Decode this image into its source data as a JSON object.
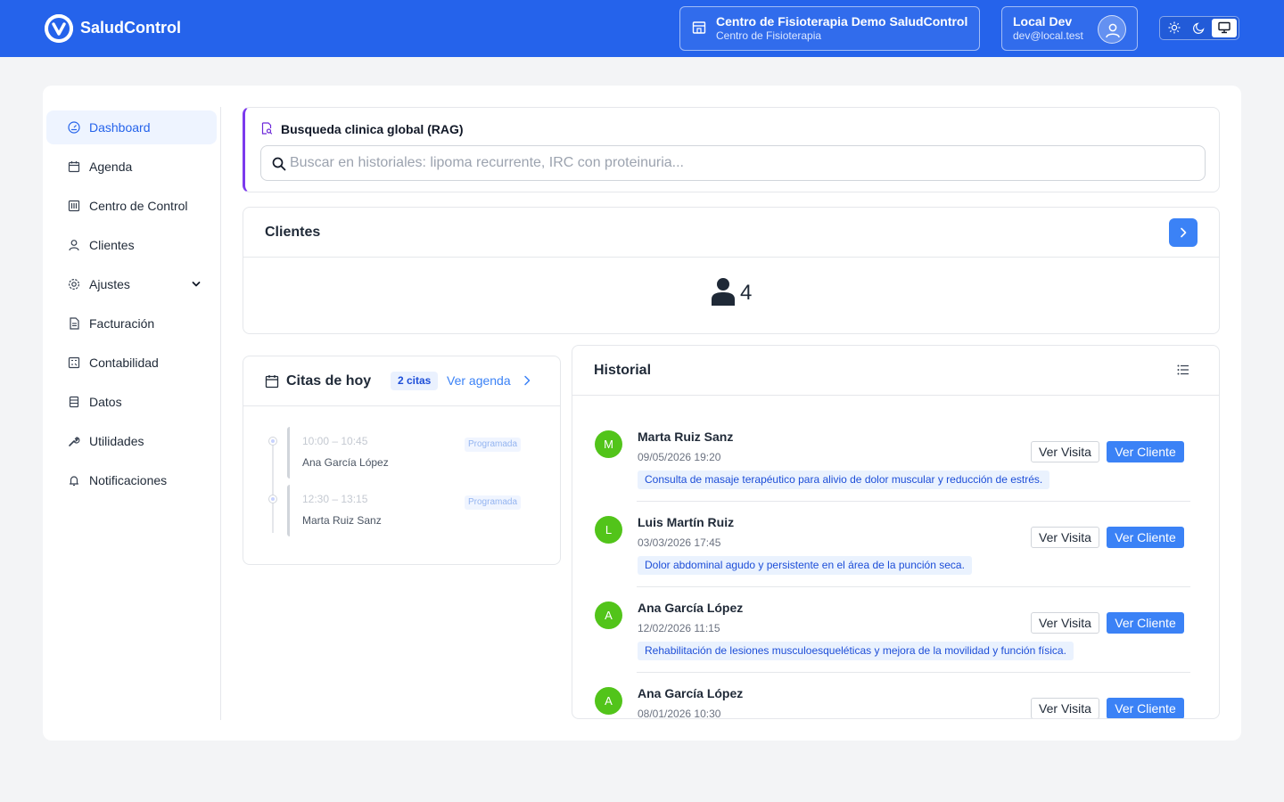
{
  "header": {
    "brand": "SaludControl",
    "center_name": "Centro de Fisioterapia Demo SaludControl",
    "center_type": "Centro de Fisioterapia",
    "user_name": "Local Dev",
    "user_email": "dev@local.test",
    "theme_options": [
      "light-mode-icon",
      "dark-mode-icon",
      "system-mode-icon"
    ],
    "theme_selected": "system"
  },
  "sidebar": {
    "items": [
      {
        "label": "Dashboard",
        "icon": "dashboard-icon",
        "active": true
      },
      {
        "label": "Agenda",
        "icon": "calendar-icon"
      },
      {
        "label": "Centro de Control",
        "icon": "control-panel-icon"
      },
      {
        "label": "Clientes",
        "icon": "user-icon"
      },
      {
        "label": "Ajustes",
        "icon": "gear-icon",
        "expandable": true
      },
      {
        "label": "Facturación",
        "icon": "invoice-icon"
      },
      {
        "label": "Contabilidad",
        "icon": "calculator-icon"
      },
      {
        "label": "Datos",
        "icon": "database-icon"
      },
      {
        "label": "Utilidades",
        "icon": "wrench-icon"
      },
      {
        "label": "Notificaciones",
        "icon": "bell-icon"
      }
    ]
  },
  "rag": {
    "title": "Busqueda clinica global (RAG)",
    "placeholder": "Buscar en historiales: lipoma recurrente, IRC con proteinuria...",
    "value": ""
  },
  "clientes": {
    "title": "Clientes",
    "count": "4"
  },
  "citas": {
    "title": "Citas de hoy",
    "badge": "2 citas",
    "link": "Ver agenda",
    "items": [
      {
        "time": "10:00 – 10:45",
        "name": "Ana García López",
        "status": "Programada"
      },
      {
        "time": "12:30 – 13:15",
        "name": "Marta Ruiz Sanz",
        "status": "Programada"
      }
    ]
  },
  "historial": {
    "title": "Historial",
    "btn_visit": "Ver Visita",
    "btn_client": "Ver Cliente",
    "entries": [
      {
        "initial": "M",
        "name": "Marta Ruiz Sanz",
        "date": "09/05/2026 19:20",
        "note": "Consulta de masaje terapéutico para alivio de dolor muscular y reducción de estrés."
      },
      {
        "initial": "L",
        "name": "Luis Martín Ruiz",
        "date": "03/03/2026 17:45",
        "note": "Dolor abdominal agudo y persistente en el área de la punción seca."
      },
      {
        "initial": "A",
        "name": "Ana García López",
        "date": "12/02/2026 11:15",
        "note": "Rehabilitación de lesiones musculoesqueléticas y mejora de la movilidad y función física."
      },
      {
        "initial": "A",
        "name": "Ana García López",
        "date": "08/01/2026 10:30",
        "note": ""
      }
    ]
  },
  "colors": {
    "header": "#2563eb",
    "accent": "#3b82f6",
    "rag_border": "#7c3aed",
    "avatar": "#52c41a"
  }
}
